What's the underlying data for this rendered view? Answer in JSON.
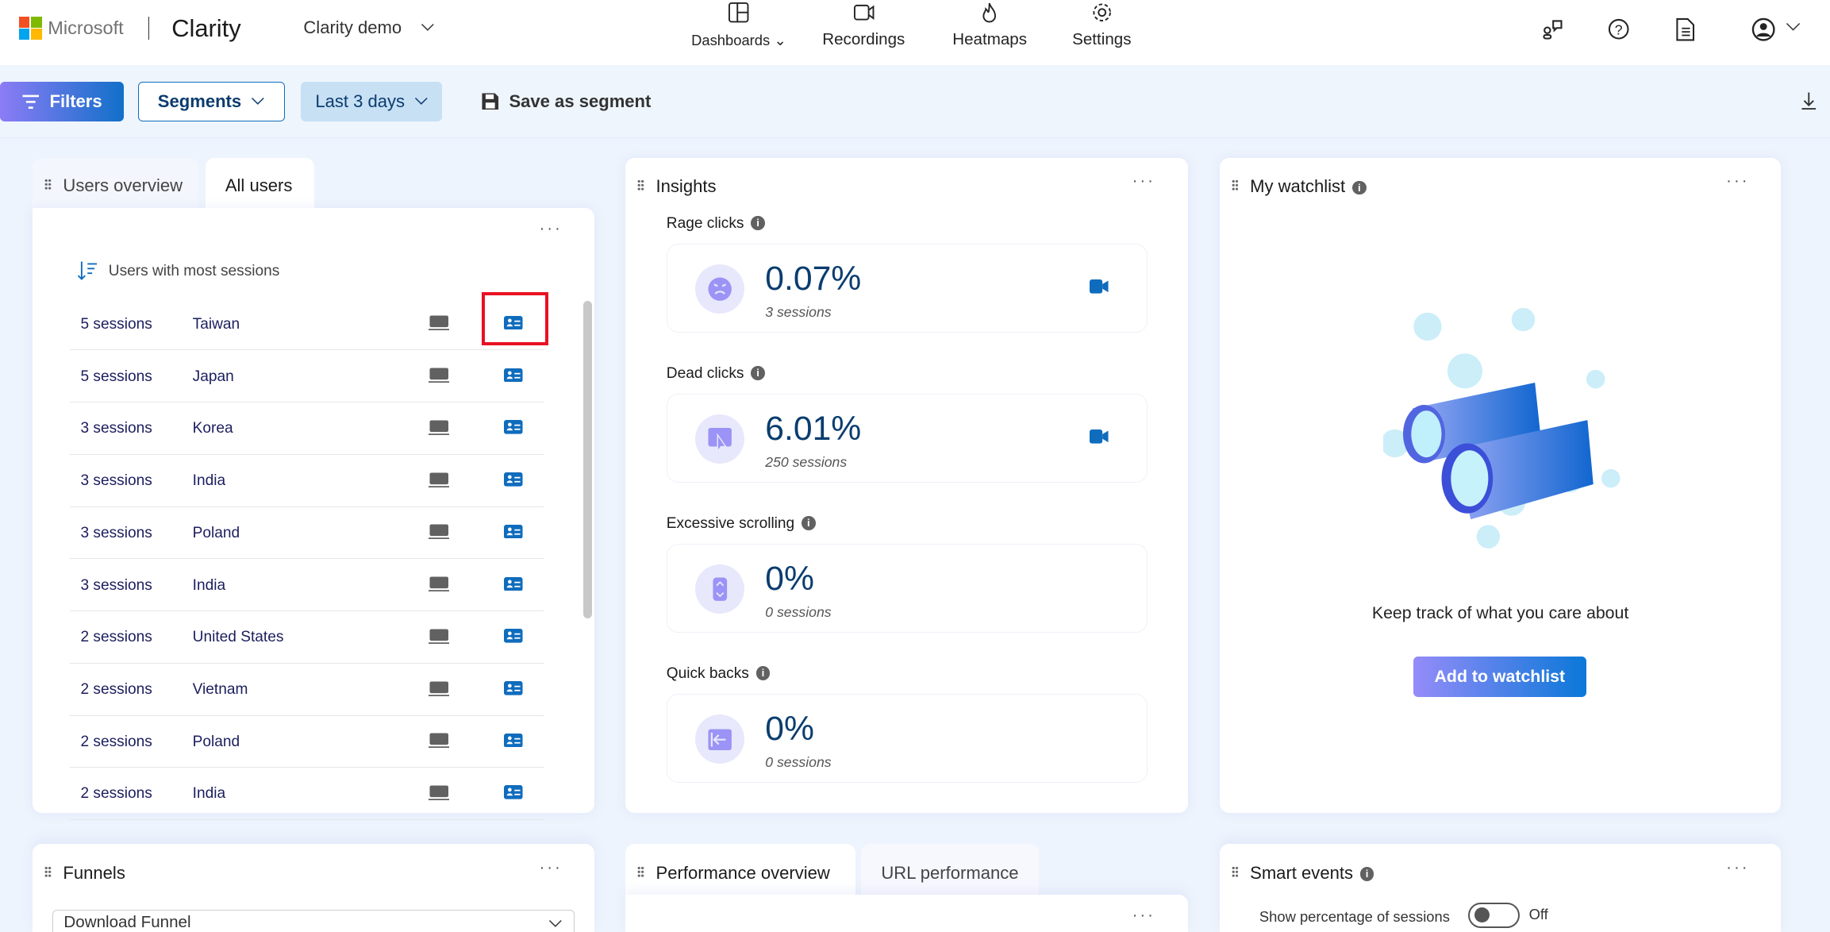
{
  "header": {
    "brand": "Microsoft",
    "product": "Clarity",
    "project": "Clarity demo",
    "nav": [
      {
        "label": "Dashboards",
        "icon": "dashboard-icon"
      },
      {
        "label": "Recordings",
        "icon": "video-icon"
      },
      {
        "label": "Heatmaps",
        "icon": "flame-icon"
      },
      {
        "label": "Settings",
        "icon": "gear-icon"
      }
    ],
    "right_icons": [
      "feedback-icon",
      "help-icon",
      "document-icon",
      "account-icon"
    ]
  },
  "toolbar": {
    "filters": "Filters",
    "segments": "Segments",
    "date_range": "Last 3 days",
    "save_segment": "Save as segment"
  },
  "users_card": {
    "tabs": [
      "Users overview",
      "All users"
    ],
    "active_tab": "All users",
    "sort_label": "Users with most sessions",
    "rows": [
      {
        "sessions": "5 sessions",
        "country": "Taiwan"
      },
      {
        "sessions": "5 sessions",
        "country": "Japan"
      },
      {
        "sessions": "3 sessions",
        "country": "Korea"
      },
      {
        "sessions": "3 sessions",
        "country": "India"
      },
      {
        "sessions": "3 sessions",
        "country": "Poland"
      },
      {
        "sessions": "3 sessions",
        "country": "India"
      },
      {
        "sessions": "2 sessions",
        "country": "United States"
      },
      {
        "sessions": "2 sessions",
        "country": "Vietnam"
      },
      {
        "sessions": "2 sessions",
        "country": "Poland"
      },
      {
        "sessions": "2 sessions",
        "country": "India"
      }
    ]
  },
  "insights": {
    "title": "Insights",
    "items": [
      {
        "label": "Rage clicks",
        "value": "0.07%",
        "sessions": "3 sessions",
        "icon": "angry-face-icon"
      },
      {
        "label": "Dead clicks",
        "value": "6.01%",
        "sessions": "250 sessions",
        "icon": "cursor-click-icon"
      },
      {
        "label": "Excessive scrolling",
        "value": "0%",
        "sessions": "0 sessions",
        "icon": "scroll-icon"
      },
      {
        "label": "Quick backs",
        "value": "0%",
        "sessions": "0 sessions",
        "icon": "back-arrow-icon"
      }
    ]
  },
  "watchlist": {
    "title": "My watchlist",
    "message": "Keep track of what you care about",
    "button": "Add to watchlist"
  },
  "funnels": {
    "title": "Funnels",
    "selected": "Download Funnel"
  },
  "performance": {
    "tabs": [
      "Performance overview",
      "URL performance"
    ],
    "active_tab": "Performance overview"
  },
  "smart_events": {
    "title": "Smart events",
    "toggle_label": "Show percentage of sessions",
    "toggle_state": "Off"
  },
  "colors": {
    "accent": "#0f6cbd",
    "highlight": "#e81123",
    "metric": "#0a3d6f"
  }
}
